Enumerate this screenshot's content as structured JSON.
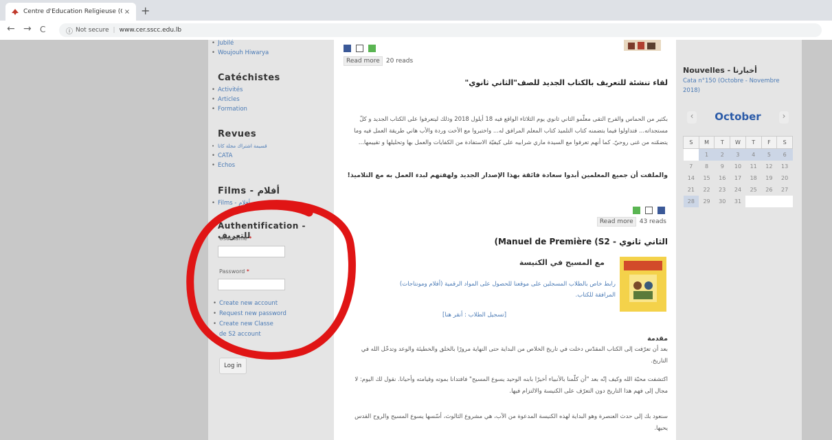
{
  "browser": {
    "tab_title": "Centre d'Education Religieuse (C",
    "tab_close": "×",
    "new_tab": "+",
    "back": "←",
    "forward": "→",
    "reload": "C",
    "security": "Not secure",
    "url": "www.cer.sscc.edu.lb"
  },
  "sidebar": {
    "top_items": [
      "Jubilé",
      "Woujouh Hiwarya"
    ],
    "catechistes": {
      "title": "Catéchistes",
      "items": [
        "Activités",
        "Articles",
        "Formation"
      ]
    },
    "revues": {
      "title": "Revues",
      "items": [
        "قسيمة اشتراك مجلة كاتا",
        "CATA",
        "Echos"
      ]
    },
    "films": {
      "title": "Films - أفلام",
      "items": [
        "Films - أفلام"
      ]
    },
    "auth": {
      "title": "Authentification - للتعريف",
      "username_label": "Username",
      "password_label": "Password",
      "required_mark": "*",
      "links": [
        "Create new account",
        "Request new password",
        "Create new Classe de S2 account"
      ],
      "login_button": "Log in"
    }
  },
  "content": {
    "post1": {
      "read_more": "Read more",
      "reads": "20 reads"
    },
    "post2": {
      "title": "لقاء تنشئة للتعريف بالكتاب الجديد للصف\"الثاني ثانوي\"",
      "body": "بكثير من الحماس والفرح التقى معلّمو الثاني ثانوي يوم الثلاثاء الواقع فيه 18 أيلول 2018 وذلك ليتعرفوا على الكتاب الجديد و كلّ مستجداته... فتداولوا فيما بتضمنه كتاب التلميذ كتاب المعلم المرافق له... واختبروا مع الأخت وردة والأب هاني طريقة العمل فيه وما يتضمّنه من غنى روحيّ. كما أنهم تعرفوا مع السيدة ماري شرابيه على كيفيّة الاستفادة من الكفايات والعمل بها وتحليلها و تقييمها...",
      "bold": "والملفت أن جميع المعلمين أبدوا سعادة فائقة بهذا الإصدار الجديد ولهفتهم لبدء العمل به مع التلاميذ!",
      "read_more": "Read more",
      "reads": "43 reads"
    },
    "post3": {
      "title": "(Manuel de Première (S2 - الثاني ثانوي",
      "subtitle": "مع المسيح في الكنيسة",
      "link": "رابط خاص بالطلاب المسجلين على موقعنا للحصول على المواد الرقمية (أفلام ومونتاجات) المرافقة للكتاب.",
      "signup": "[تسجيل الطلاب : أنقر هنا]",
      "intro_head": "مقدمة",
      "p1": "بعد أن تعرّفت إلى الكتاب المقدّس دخلت في تاريخ الخلاص من البداية حتى النهاية مرورًا بالخلق والخطيئة والوعد وتدخّل الله في التاريخ.",
      "p2": "اكتشفت محبّة الله وكيف إنّه بعد \"أن كلّمنا بالأنبياء أخيرًا بابنه الوحيد يسوع المسيح\" فافتدانا بموته وقيامته وأحيانا. نقول لك اليوم: لا مجال إلى فهم هذا التاريخ دون التعرّف على الكنيسة والالتزام فيها.",
      "p3": "سنعود بك إلى حدث العنصرة وهو البداية لهذه الكنيسة المدعوة من الآب، هي مشروع الثالوث، أسّسها يسوع المسيح والروح القدس يحيها."
    }
  },
  "right": {
    "news_title": "Nouvelles - أخبارنا",
    "news_link": "Cata n°150 (Octobre - Novembre 2018)",
    "month": "October",
    "prev": "‹",
    "next": "›",
    "weekdays": [
      "S",
      "M",
      "T",
      "W",
      "T",
      "F",
      "S"
    ],
    "weeks": [
      [
        "",
        "1",
        "2",
        "3",
        "4",
        "5",
        "6"
      ],
      [
        "7",
        "8",
        "9",
        "10",
        "11",
        "12",
        "13"
      ],
      [
        "14",
        "15",
        "16",
        "17",
        "18",
        "19",
        "20"
      ],
      [
        "21",
        "22",
        "23",
        "24",
        "25",
        "26",
        "27"
      ],
      [
        "28",
        "29",
        "30",
        "31",
        "",
        "",
        ""
      ]
    ]
  },
  "colors": {
    "link": "#4a7ab5",
    "annotation": "#e01515",
    "calendar_month": "#2a5aa8"
  }
}
